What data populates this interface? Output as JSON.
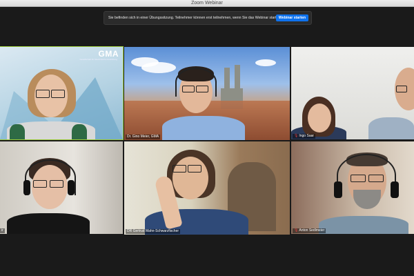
{
  "window": {
    "title": "Zoom Webinar"
  },
  "banner": {
    "message": "Sie befinden sich in einer Übungssitzung. Teilnehmer können erst teilnehmen, wenn Sie das Webinar starten.",
    "button_label": "Webinar starten"
  },
  "tiles": [
    {
      "name": "",
      "logo": "GMA",
      "logo_sub": "Gesellschaft für Medizinische Ausbildung"
    },
    {
      "name": "Dr. Gino Meier, GMA"
    },
    {
      "name": "Ingo Saar"
    },
    {
      "name": "ir"
    },
    {
      "name": "DR Gertrud Mahn-Schwarzfischer"
    },
    {
      "name": "Anton Sedlmeier"
    }
  ],
  "colors": {
    "accent": "#0e72ed",
    "active_speaker": "#9ccc3a",
    "muted": "#e04141"
  }
}
